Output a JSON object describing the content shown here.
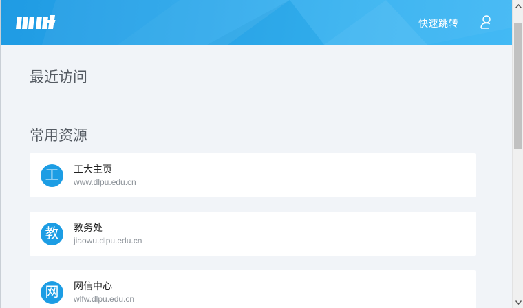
{
  "header": {
    "quick_jump_label": "快速跳转",
    "logo_icon": "wit-logo-icon",
    "user_icon": "user-icon",
    "colors": {
      "start": "#1f9be3",
      "end": "#43b9f4"
    }
  },
  "sections": {
    "recent_title": "最近访问",
    "common_title": "常用资源"
  },
  "resources": [
    {
      "badge": "工",
      "name": "工大主页",
      "url": "www.dlpu.edu.cn"
    },
    {
      "badge": "教",
      "name": "教务处",
      "url": "jiaowu.dlpu.edu.cn"
    },
    {
      "badge": "网",
      "name": "网信中心",
      "url": "wlfw.dlpu.edu.cn"
    }
  ],
  "accent_color": "#1c9de4"
}
